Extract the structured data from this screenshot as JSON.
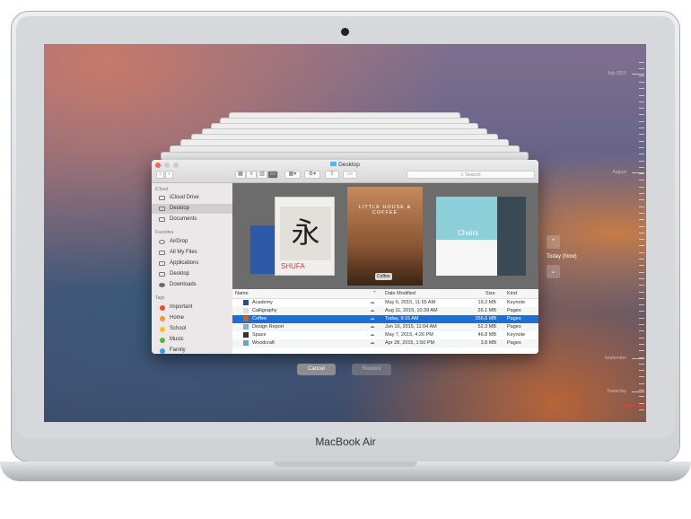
{
  "device": {
    "brand": "MacBook Air"
  },
  "finder": {
    "title": "Desktop",
    "search_placeholder": "Search",
    "sidebar": {
      "icloud_header": "iCloud",
      "icloud": [
        "iCloud Drive",
        "Desktop",
        "Documents"
      ],
      "favorites_header": "Favorites",
      "favorites": [
        "AirDrop",
        "All My Files",
        "Applications",
        "Desktop",
        "Downloads"
      ],
      "tags_header": "Tags",
      "tags": [
        {
          "label": "Important",
          "color": "#f0453a"
        },
        {
          "label": "Home",
          "color": "#f6952a"
        },
        {
          "label": "School",
          "color": "#f7c21f"
        },
        {
          "label": "Music",
          "color": "#5cb531"
        },
        {
          "label": "Family",
          "color": "#3b9bea"
        }
      ]
    },
    "cover": {
      "shufa": "SHUFA",
      "coffee_title": "LITTLE HOUSE & COFFEE",
      "coffee_label": "Coffee",
      "chairs": "Chairs"
    },
    "columns": {
      "name": "Name",
      "date": "Date Modified",
      "size": "Size",
      "kind": "Kind"
    },
    "files": [
      {
        "name": "Academy",
        "date": "May 6, 2015, 11:55 AM",
        "size": "19.2 MB",
        "kind": "Keynote",
        "icon": "#2b4d8a"
      },
      {
        "name": "Calligraphy",
        "date": "Aug 11, 2015, 10:39 AM",
        "size": "26.1 MB",
        "kind": "Pages",
        "icon": "#ddd"
      },
      {
        "name": "Coffee",
        "date": "Today, 9:15 AM",
        "size": "256.6 MB",
        "kind": "Pages",
        "icon": "#c0652b"
      },
      {
        "name": "Design Report",
        "date": "Jun 16, 2015, 11:04 AM",
        "size": "52.3 MB",
        "kind": "Pages",
        "icon": "#7fb7c7"
      },
      {
        "name": "Space",
        "date": "May 7, 2015, 4:26 PM",
        "size": "46.8 MB",
        "kind": "Keynote",
        "icon": "#333"
      },
      {
        "name": "Woodcraft",
        "date": "Apr 28, 2015, 1:50 PM",
        "size": "3.8 MB",
        "kind": "Pages",
        "icon": "#6aa1c9"
      }
    ],
    "selected_index": 2
  },
  "time_machine": {
    "cancel": "Cancel",
    "restore": "Restore",
    "current": "Today (Now)",
    "timeline": [
      "July 2015",
      "August",
      "September",
      "Yesterday",
      "Now"
    ],
    "now_color": "#ff3b30"
  }
}
